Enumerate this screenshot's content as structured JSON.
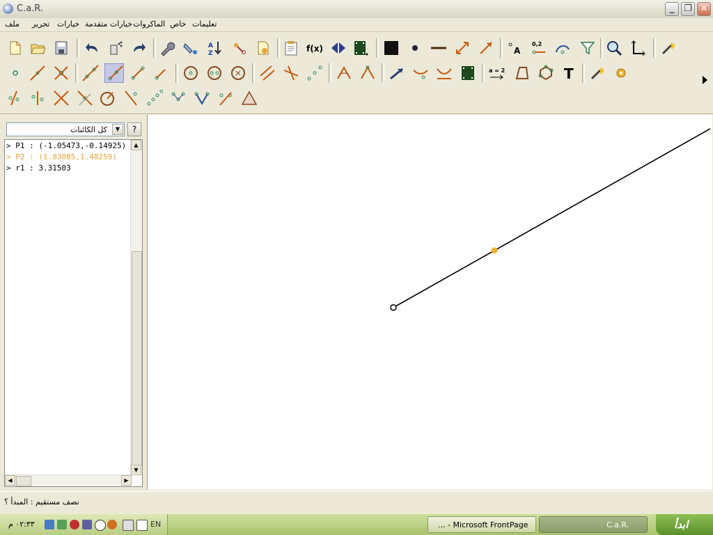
{
  "window": {
    "title": "C.a.R.",
    "minimize_glyph": "_",
    "maximize_glyph": "❐",
    "close_glyph": "✕"
  },
  "menu": {
    "items": [
      "ملف",
      "تحرير",
      "خيارات",
      "خيارات متقدمة",
      "الماكروات",
      "خاص",
      "تعليمات"
    ]
  },
  "left_panel": {
    "filter_dropdown": "كل الكائنات",
    "help_label": "?",
    "objects": [
      {
        "text": "> P1 : (-1.05473,-0.14925)",
        "color": "#000000"
      },
      {
        "text": "> P2 : (1.83085,1.48259)",
        "color": "#e8a33a"
      },
      {
        "text": "> r1 : 3.31503",
        "color": "#000000"
      }
    ]
  },
  "canvas": {
    "colors": {
      "line": "#000000",
      "selected_point": "#f0b030",
      "point_fill": "#ffffff"
    }
  },
  "statusbar": {
    "text": "نصف مستقيم : المبدأ ؟"
  },
  "taskbar": {
    "clock": "٠٢:٣٣ م",
    "language": "EN",
    "tasks": [
      "... - Microsoft FrontPage",
      "C.a.R."
    ],
    "start_label": "ابدأ"
  },
  "toolbar": {
    "fx_label": "f(x)",
    "decimal_label": "0,2",
    "assign_label": "a = 2",
    "text_tool_label": "T"
  }
}
